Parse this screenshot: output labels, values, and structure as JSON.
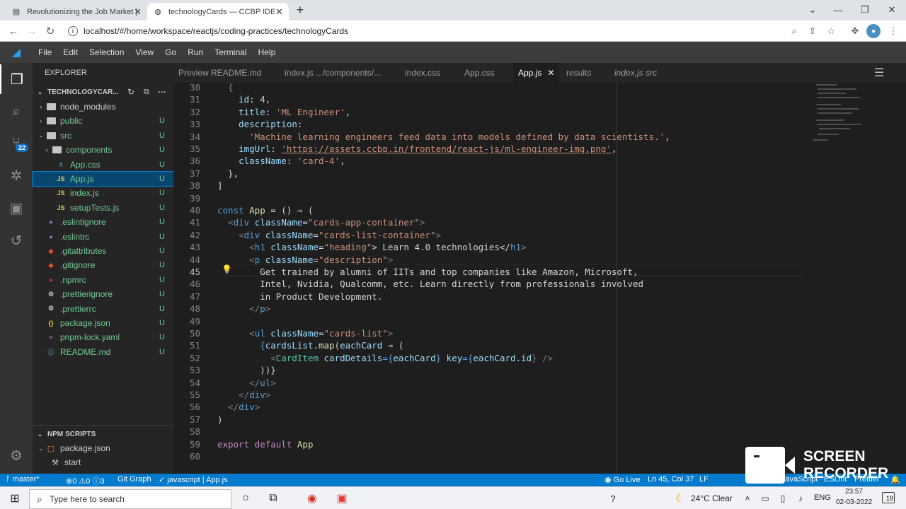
{
  "browser": {
    "tabs": [
      {
        "title": "Revolutionizing the Job Market |",
        "active": false
      },
      {
        "title": "technologyCards — CCBP IDE",
        "active": true
      }
    ],
    "url": "localhost/#/home/workspace/reactjs/coding-practices/technologyCards"
  },
  "menu": [
    "File",
    "Edit",
    "Selection",
    "View",
    "Go",
    "Run",
    "Terminal",
    "Help"
  ],
  "activity": {
    "scm_badge": "22"
  },
  "explorer": {
    "title": "EXPLORER",
    "project": "TECHNOLOGYCAR...",
    "items": [
      {
        "label": "node_modules",
        "kind": "folder",
        "chev": "›",
        "u": ""
      },
      {
        "label": "public",
        "kind": "folder",
        "chev": "›",
        "u": "U"
      },
      {
        "label": "src",
        "kind": "folder",
        "chev": "⌄",
        "u": "U"
      },
      {
        "label": "components",
        "kind": "folder",
        "chev": "›",
        "u": "U"
      },
      {
        "label": "App.css",
        "kind": "css",
        "chev": "",
        "u": "U"
      },
      {
        "label": "App.js",
        "kind": "js",
        "chev": "",
        "u": "U"
      },
      {
        "label": "index.js",
        "kind": "js",
        "chev": "",
        "u": "U"
      },
      {
        "label": "setupTests.js",
        "kind": "js",
        "chev": "",
        "u": "U"
      },
      {
        "label": ".eslintignore",
        "kind": "dot",
        "chev": "",
        "u": "U"
      },
      {
        "label": ".eslintrc",
        "kind": "dot",
        "chev": "",
        "u": "U"
      },
      {
        "label": ".gitattributes",
        "kind": "git",
        "chev": "",
        "u": "U"
      },
      {
        "label": ".gitignore",
        "kind": "git",
        "chev": "",
        "u": "U"
      },
      {
        "label": ".npmrc",
        "kind": "npm",
        "chev": "",
        "u": "U"
      },
      {
        "label": ".prettierignore",
        "kind": "gear",
        "chev": "",
        "u": "U"
      },
      {
        "label": ".prettierrc",
        "kind": "gear",
        "chev": "",
        "u": "U"
      },
      {
        "label": "package.json",
        "kind": "json",
        "chev": "",
        "u": "U"
      },
      {
        "label": "pnpm-lock.yaml",
        "kind": "yaml",
        "chev": "",
        "u": "U"
      },
      {
        "label": "README.md",
        "kind": "md",
        "chev": "",
        "u": "U"
      }
    ],
    "npm": {
      "title": "NPM SCRIPTS",
      "package": "package.json",
      "script": "start"
    }
  },
  "editor_tabs": [
    {
      "label": "Preview README.md"
    },
    {
      "label": "index.js .../components/..."
    },
    {
      "label": "index.css"
    },
    {
      "label": "App.css"
    },
    {
      "label": "App.js"
    },
    {
      "label": "results"
    },
    {
      "label": "index.js src"
    }
  ],
  "code": {
    "line_numbers": [
      "30",
      "31",
      "32",
      "33",
      "34",
      "35",
      "36",
      "37",
      "38",
      "39",
      "40",
      "41",
      "42",
      "43",
      "44",
      "45",
      "46",
      "47",
      "48",
      "49",
      "50",
      "51",
      "52",
      "53",
      "54",
      "55",
      "56",
      "57",
      "58",
      "59",
      "60"
    ],
    "l30": "  {",
    "l31a": "    id",
    "l31b": ": ",
    "l31c": "4",
    "l31d": ",",
    "l32a": "    title",
    "l32b": ": ",
    "l32c": "'ML Engineer'",
    "l32d": ",",
    "l33a": "    description",
    "l33b": ":",
    "l34a": "      ",
    "l34b": "'Machine learning engineers feed data into models defined by data scientists.'",
    "l34c": ",",
    "l35a": "    imgUrl",
    "l35b": ": ",
    "l35c": "'https://assets.ccbp.in/frontend/react-js/ml-engineer-img.png'",
    "l35d": ",",
    "l36a": "    className",
    "l36b": ": ",
    "l36c": "'card-4'",
    "l36d": ",",
    "l37": "  },",
    "l38": "]",
    "l40a": "const ",
    "l40b": "App",
    "l40c": " = () ⇒ (",
    "l41a": "  <",
    "l41b": "div ",
    "l41c": "className",
    "l41d": "=",
    "l41e": "\"cards-app-container\"",
    "l41f": ">",
    "l42a": "    <",
    "l42b": "div ",
    "l42c": "className",
    "l42d": "=",
    "l42e": "\"cards-list-container\"",
    "l42f": ">",
    "l43a": "      <",
    "l43b": "h1 ",
    "l43c": "className",
    "l43d": "=",
    "l43e": "\"heading\"",
    "l43f": "> Learn 4.0 technologies</",
    "l43g": "h1",
    "l43h": ">",
    "l44a": "      <",
    "l44b": "p ",
    "l44c": "className",
    "l44d": "=",
    "l44e": "\"description\"",
    "l44f": ">",
    "l45": "        Get trained by alumni of IITs and top companies like Amazon, Microsoft,",
    "l46": "        Intel, Nvidia, Qualcomm, etc. Learn directly from professionals involved",
    "l47": "        in Product Development.",
    "l48a": "      </",
    "l48b": "p",
    "l48c": ">",
    "l50a": "      <",
    "l50b": "ul ",
    "l50c": "className",
    "l50d": "=",
    "l50e": "\"cards-list\"",
    "l50f": ">",
    "l51a": "        {",
    "l51b": "cardsList",
    "l51c": ".",
    "l51d": "map",
    "l51e": "(",
    "l51f": "eachCard",
    "l51g": " ⇒ (",
    "l52a": "          <",
    "l52b": "CardItem ",
    "l52c": "cardDetails",
    "l52d": "={",
    "l52e": "eachCard",
    "l52f": "} ",
    "l52g": "key",
    "l52h": "={",
    "l52i": "eachCard.id",
    "l52j": "} />",
    "l53": "        ))}",
    "l54a": "      </",
    "l54b": "ul",
    "l54c": ">",
    "l55a": "    </",
    "l55b": "div",
    "l55c": ">",
    "l56a": "  </",
    "l56b": "div",
    "l56c": ">",
    "l57": ")",
    "l59a": "export default ",
    "l59b": "App"
  },
  "status": {
    "branch": "master*",
    "problems": "0",
    "warnings": "0",
    "infos": "3",
    "gitgraph": "Git Graph",
    "lang_left": "javascript",
    "file": "App.js",
    "golive": "Go Live",
    "position": "Ln 45, Col 37",
    "eol": "LF",
    "lang": "JavaScript",
    "eslint": "ESLint",
    "prettier": "Prettier"
  },
  "taskbar": {
    "search_placeholder": "Type here to search",
    "weather": "24°C  Clear",
    "lang": "ENG",
    "time": "23:57",
    "date": "02-03-2022",
    "notif": "19"
  },
  "recorder": {
    "line1": "SCREEN",
    "line2": "RECORDER"
  }
}
